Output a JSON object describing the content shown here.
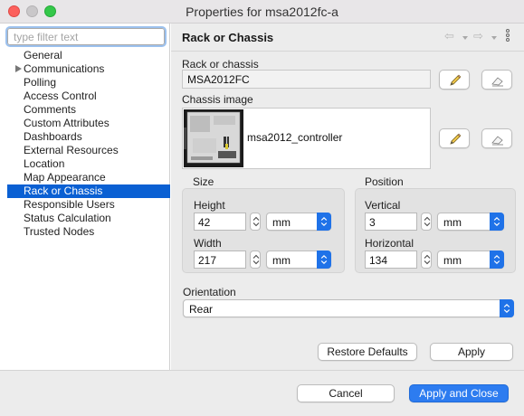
{
  "window": {
    "title": "Properties for msa2012fc-a"
  },
  "sidebar": {
    "filter_placeholder": "type filter text",
    "items": [
      {
        "label": "General",
        "expandable": false,
        "selected": false
      },
      {
        "label": "Communications",
        "expandable": true,
        "selected": false
      },
      {
        "label": "Polling",
        "expandable": false,
        "selected": false
      },
      {
        "label": "Access Control",
        "expandable": false,
        "selected": false
      },
      {
        "label": "Comments",
        "expandable": false,
        "selected": false
      },
      {
        "label": "Custom Attributes",
        "expandable": false,
        "selected": false
      },
      {
        "label": "Dashboards",
        "expandable": false,
        "selected": false
      },
      {
        "label": "External Resources",
        "expandable": false,
        "selected": false
      },
      {
        "label": "Location",
        "expandable": false,
        "selected": false
      },
      {
        "label": "Map Appearance",
        "expandable": false,
        "selected": false
      },
      {
        "label": "Rack or Chassis",
        "expandable": false,
        "selected": true
      },
      {
        "label": "Responsible Users",
        "expandable": false,
        "selected": false
      },
      {
        "label": "Status Calculation",
        "expandable": false,
        "selected": false
      },
      {
        "label": "Trusted Nodes",
        "expandable": false,
        "selected": false
      }
    ]
  },
  "page": {
    "title": "Rack or Chassis",
    "nav_icons": {
      "back": "back-arrow-icon",
      "forward": "forward-arrow-icon",
      "menu": "more-vertical-icon"
    },
    "rack": {
      "label": "Rack or chassis",
      "value": "MSA2012FC",
      "select_icon": "pencil-icon",
      "clear_icon": "eraser-icon"
    },
    "chassis_image": {
      "label": "Chassis image",
      "name": "msa2012_controller",
      "select_icon": "pencil-icon",
      "clear_icon": "eraser-icon"
    },
    "size": {
      "label": "Size",
      "height_label": "Height",
      "height_value": "42",
      "height_unit": "mm",
      "width_label": "Width",
      "width_value": "217",
      "width_unit": "mm"
    },
    "position": {
      "label": "Position",
      "vertical_label": "Vertical",
      "vertical_value": "3",
      "vertical_unit": "mm",
      "horizontal_label": "Horizontal",
      "horizontal_value": "134",
      "horizontal_unit": "mm"
    },
    "orientation": {
      "label": "Orientation",
      "value": "Rear"
    },
    "restore_defaults_label": "Restore Defaults",
    "apply_label": "Apply"
  },
  "footer": {
    "cancel_label": "Cancel",
    "apply_close_label": "Apply and Close"
  },
  "colors": {
    "accent": "#0a60d3",
    "primary_button": "#2d7cf0",
    "panel": "#ececec"
  }
}
